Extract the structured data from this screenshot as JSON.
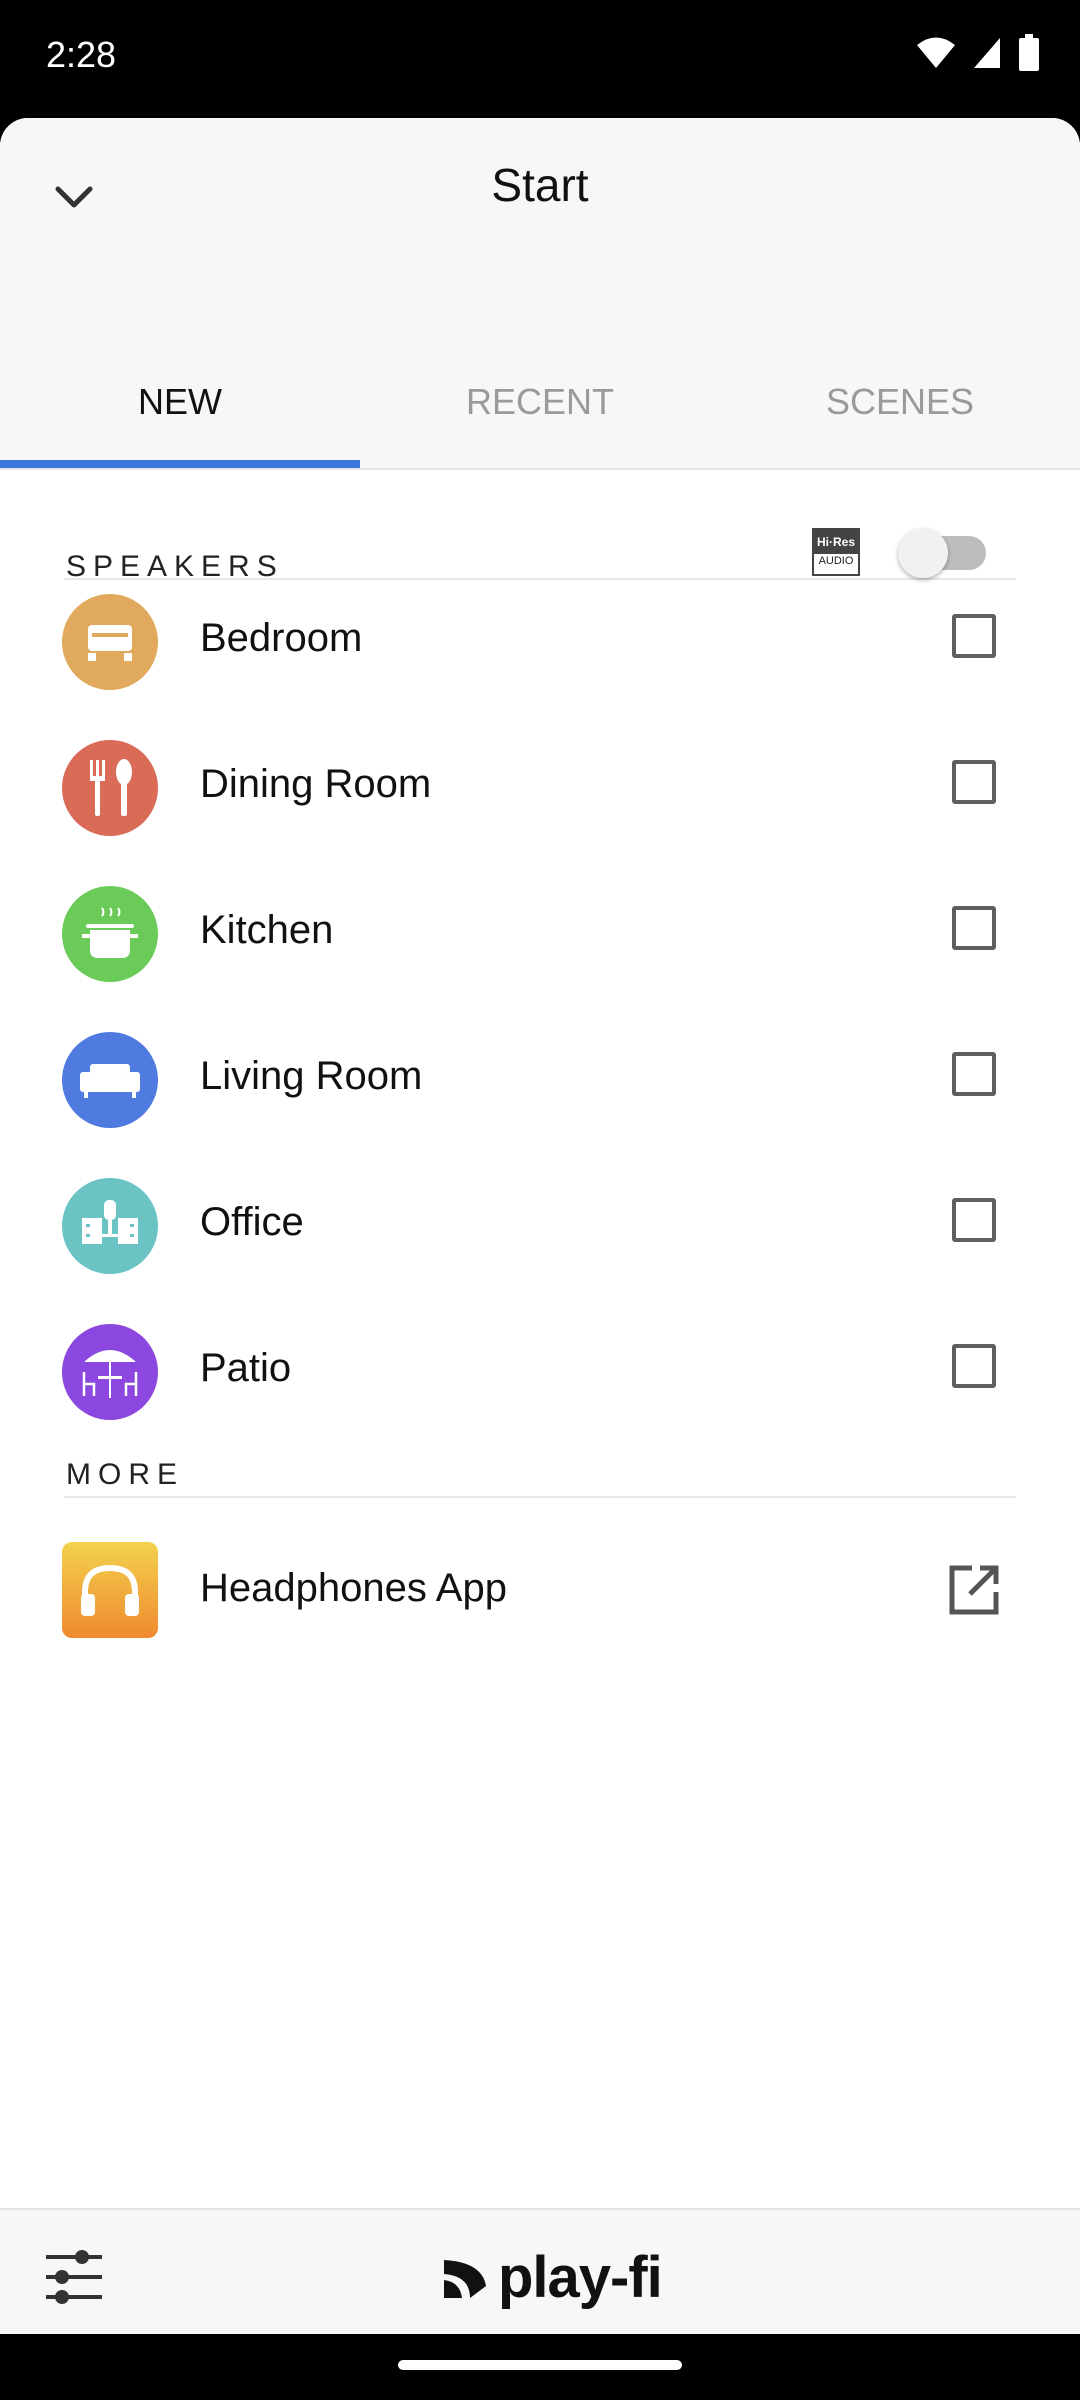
{
  "status_bar": {
    "time": "2:28"
  },
  "header": {
    "title": "Start"
  },
  "tabs": [
    {
      "label": "NEW",
      "active": true
    },
    {
      "label": "RECENT",
      "active": false
    },
    {
      "label": "SCENES",
      "active": false
    }
  ],
  "speakers": {
    "section_label": "SPEAKERS",
    "hires_badge": {
      "top": "Hi·Res",
      "bottom": "AUDIO"
    },
    "hires_toggle_on": false,
    "items": [
      {
        "label": "Bedroom",
        "icon": "bed-icon",
        "color": "#E1A95C",
        "checked": false
      },
      {
        "label": "Dining Room",
        "icon": "utensils-icon",
        "color": "#D96B57",
        "checked": false
      },
      {
        "label": "Kitchen",
        "icon": "pot-icon",
        "color": "#6BCB59",
        "checked": false
      },
      {
        "label": "Living Room",
        "icon": "sofa-icon",
        "color": "#4F7BE0",
        "checked": false
      },
      {
        "label": "Office",
        "icon": "desk-icon",
        "color": "#6CC3C4",
        "checked": false
      },
      {
        "label": "Patio",
        "icon": "umbrella-table-icon",
        "color": "#8B47DF",
        "checked": false
      }
    ]
  },
  "more": {
    "section_label": "MORE",
    "items": [
      {
        "label": "Headphones App",
        "icon": "headphones-icon",
        "action_icon": "open-external-icon"
      }
    ]
  },
  "footer": {
    "logo_text": "play-fi"
  },
  "colors": {
    "accent": "#3A76DE",
    "header_bg": "#F7F7F7"
  }
}
